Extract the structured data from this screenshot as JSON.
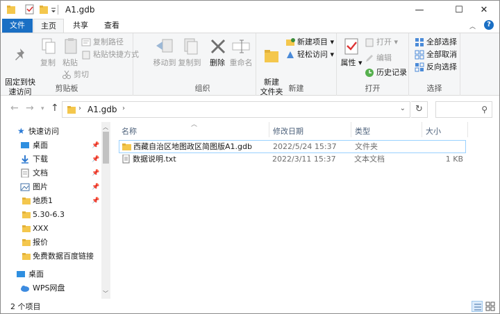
{
  "window": {
    "title": "A1.gdb",
    "minimize_glyph": "—",
    "maximize_glyph": "☐",
    "close_glyph": "✕"
  },
  "ribbon_tabs": {
    "file": "文件",
    "home": "主页",
    "share": "共享",
    "view": "查看",
    "help": "?"
  },
  "clipboard": {
    "pin_quick_access": "固定到快\n速访问",
    "copy": "复制",
    "paste": "粘贴",
    "copy_path": "复制路径",
    "paste_shortcut": "粘贴快捷方式",
    "cut": "剪切",
    "label": "剪贴板"
  },
  "organize": {
    "move_to": "移动到",
    "copy_to": "复制到",
    "delete": "删除",
    "rename": "重命名",
    "label": "组织"
  },
  "new": {
    "new_folder": "新建\n文件夹",
    "new_item": "新建项目",
    "easy_access": "轻松访问",
    "label": "新建"
  },
  "open": {
    "properties": "属性",
    "open": "打开",
    "edit": "编辑",
    "history": "历史记录",
    "label": "打开"
  },
  "select": {
    "select_all": "全部选择",
    "select_none": "全部取消",
    "invert": "反向选择",
    "label": "选择"
  },
  "address": {
    "path": "A1.gdb"
  },
  "nav_pane": {
    "quick_access": "快速访问",
    "items": [
      {
        "label": "桌面",
        "icon": "desktop-icon",
        "pinned": true
      },
      {
        "label": "下载",
        "icon": "download-icon",
        "pinned": true
      },
      {
        "label": "文档",
        "icon": "document-icon",
        "pinned": true
      },
      {
        "label": "图片",
        "icon": "picture-icon",
        "pinned": true
      },
      {
        "label": "地质1",
        "icon": "folder-icon",
        "pinned": true
      },
      {
        "label": "5.30-6.3",
        "icon": "folder-icon",
        "pinned": false
      },
      {
        "label": "XXX",
        "icon": "folder-icon",
        "pinned": false
      },
      {
        "label": "报价",
        "icon": "folder-icon",
        "pinned": false
      },
      {
        "label": "免费数据百度链接",
        "icon": "folder-icon",
        "pinned": false
      }
    ],
    "desktop": "桌面",
    "wps": "WPS网盘"
  },
  "columns": {
    "name": "名称",
    "modified": "修改日期",
    "type": "类型",
    "size": "大小"
  },
  "files": [
    {
      "name": "西藏自治区地图政区简图版A1.gdb",
      "modified": "2022/5/24 15:37",
      "type": "文件夹",
      "size": "",
      "icon": "folder-icon"
    },
    {
      "name": "数据说明.txt",
      "modified": "2022/3/11 15:37",
      "type": "文本文档",
      "size": "1 KB",
      "icon": "text-file-icon"
    }
  ],
  "status": {
    "count": "2 个项目"
  },
  "colors": {
    "accent": "#1a6fc4",
    "folder": "#f4c74d",
    "selection_border": "#99d1ff"
  }
}
